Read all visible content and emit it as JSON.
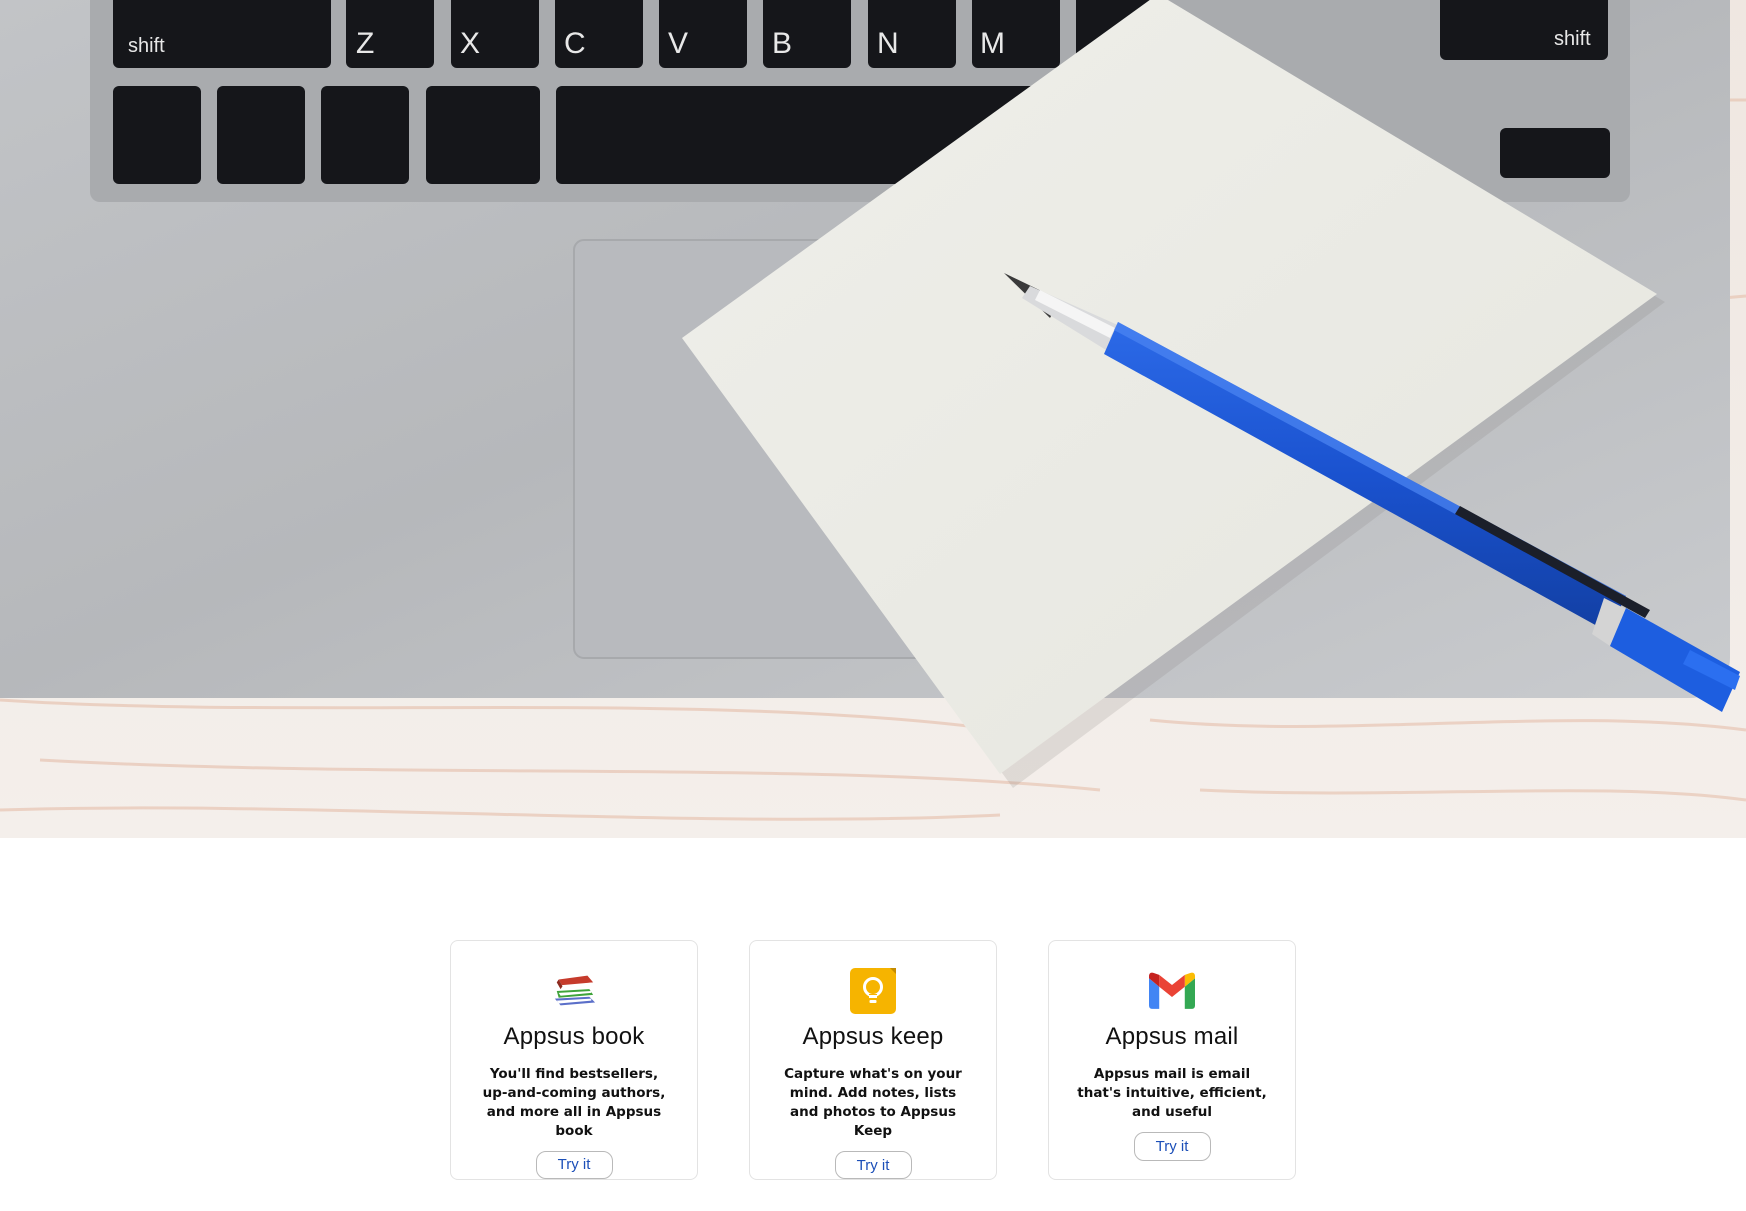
{
  "hero": {
    "keyboard_keys": {
      "shift_left": "shift",
      "letters": [
        "Z",
        "X",
        "C",
        "V",
        "B",
        "N",
        "M"
      ],
      "shift_right": "shift"
    }
  },
  "apps": [
    {
      "title": "Appsus book",
      "description": "You'll find bestsellers, up-and-coming authors, and more all in Appsus book",
      "button": "Try it",
      "icon": "books-icon"
    },
    {
      "title": "Appsus keep",
      "description": "Capture what's on your mind. Add notes, lists and photos to Appsus Keep",
      "button": "Try it",
      "icon": "lightbulb-icon"
    },
    {
      "title": "Appsus mail",
      "description": "Appsus mail is email that's intuitive, efficient, and useful",
      "button": "Try it",
      "icon": "gmail-icon"
    }
  ],
  "colors": {
    "button_text": "#1c4fb8",
    "keep_yellow": "#f6b400",
    "pencil_blue": "#1a56d6"
  }
}
